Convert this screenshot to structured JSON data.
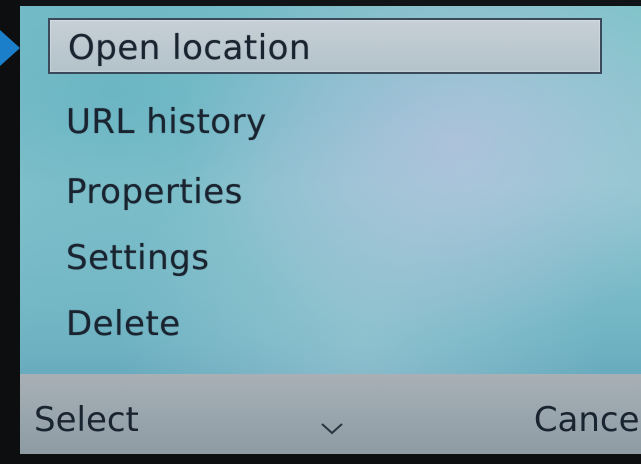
{
  "menu": {
    "items": [
      {
        "label": "Open location",
        "selected": true
      },
      {
        "label": "URL history",
        "selected": false
      },
      {
        "label": "Properties",
        "selected": false
      },
      {
        "label": "Settings",
        "selected": false
      },
      {
        "label": "Delete",
        "selected": false
      }
    ]
  },
  "softkeys": {
    "left_label": "Select",
    "right_label": "Cancel"
  },
  "colors": {
    "pointer": "#1c7fc9",
    "selection_border": "#3a4a5a"
  },
  "icons": {
    "pointer": "arrow-pointer-icon",
    "scroll": "chevron-down-icon"
  }
}
